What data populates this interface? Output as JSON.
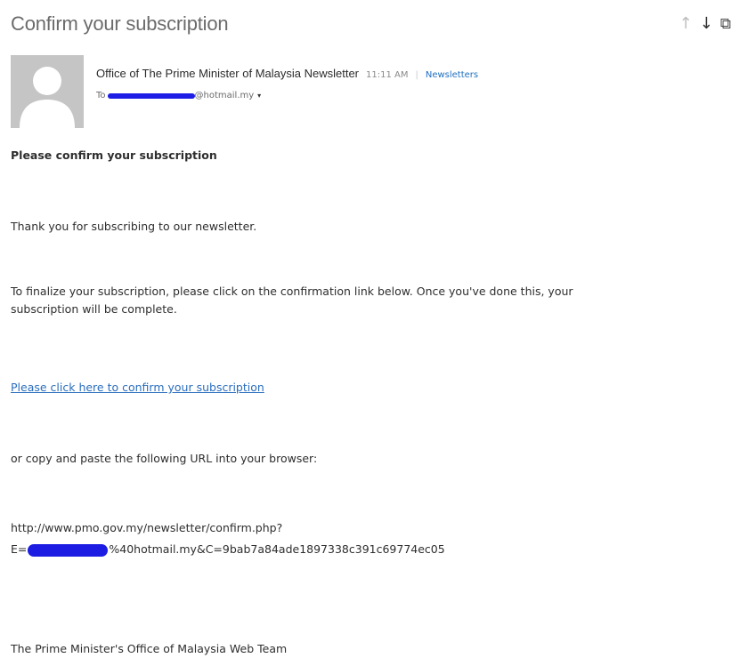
{
  "email": {
    "subject": "Confirm your subscription",
    "sender": "Office of The Prime Minister of Malaysia Newsletter",
    "time": "11:11 AM",
    "folder_separator": "|",
    "folder": "Newsletters",
    "to_prefix": "To",
    "to_email_suffix": "@hotmail.my",
    "body": {
      "heading": "Please confirm your subscription",
      "thanks": "Thank you for subscribing to our newsletter.",
      "finalize_line1": "To finalize your subscription, please click on the confirmation link below. Once you've done this, your",
      "finalize_line2": "subscription will be complete.",
      "confirm_link": "Please click here to confirm your subscription",
      "copy_paste": "or copy and paste the following URL into your browser:",
      "url_line1": "http://www.pmo.gov.my/newsletter/confirm.php?",
      "url_line2_prefix": "E=",
      "url_line2_suffix": "%40hotmail.my&C=9bab7a84ade1897338c391c69774ec05",
      "signoff": "The Prime Minister's Office of Malaysia Web Team"
    }
  },
  "toolbar": {
    "up_icon": "↑",
    "down_icon": "↓",
    "popout_icon": "⧉"
  },
  "colors": {
    "link": "#2a6ebd",
    "redaction": "#1c1ce3",
    "avatar_bg": "#c5c5c5"
  }
}
